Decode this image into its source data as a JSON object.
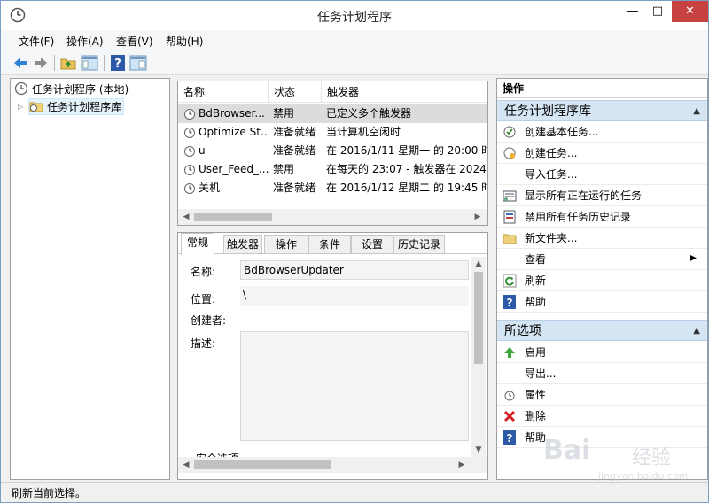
{
  "window": {
    "title": "任务计划程序"
  },
  "menubar": {
    "items": [
      "文件(F)",
      "操作(A)",
      "查看(V)",
      "帮助(H)"
    ]
  },
  "toolbar": {
    "icons": [
      "back-icon",
      "forward-icon",
      "up-folder-icon",
      "show-hide-tree-icon",
      "help-icon",
      "show-hide-action-pane-icon"
    ]
  },
  "tree": {
    "root": "任务计划程序 (本地)",
    "child": "任务计划程序库"
  },
  "task_list": {
    "columns": [
      "名称",
      "状态",
      "触发器"
    ],
    "rows": [
      {
        "name": "BdBrowser...",
        "status": "禁用",
        "trigger": "已定义多个触发器"
      },
      {
        "name": "Optimize St...",
        "status": "准备就绪",
        "trigger": "当计算机空闲时"
      },
      {
        "name": "u",
        "status": "准备就绪",
        "trigger": "在 2016/1/11 星期一 的 20:00 时"
      },
      {
        "name": "User_Feed_...",
        "status": "禁用",
        "trigger": "在每天的 23:07 - 触发器在 2024/"
      },
      {
        "name": "关机",
        "status": "准备就绪",
        "trigger": "在 2016/1/12 星期二 的 19:45 时"
      }
    ]
  },
  "detail": {
    "tabs": [
      "常规",
      "触发器",
      "操作",
      "条件",
      "设置",
      "历史记录"
    ],
    "name_label": "名称:",
    "name_value": "BdBrowserUpdater",
    "location_label": "位置:",
    "location_value": "\\",
    "author_label": "创建者:",
    "description_label": "描述:",
    "security_label": "安全选项"
  },
  "actions": {
    "title": "操作",
    "library_section": "任务计划程序库",
    "library_items": [
      {
        "label": "创建基本任务...",
        "icon": "create-basic-task-icon"
      },
      {
        "label": "创建任务...",
        "icon": "create-task-icon"
      },
      {
        "label": "导入任务...",
        "icon": ""
      },
      {
        "label": "显示所有正在运行的任务",
        "icon": "running-tasks-icon"
      },
      {
        "label": "禁用所有任务历史记录",
        "icon": "history-icon"
      },
      {
        "label": "新文件夹...",
        "icon": "new-folder-icon"
      },
      {
        "label": "查看",
        "icon": ""
      },
      {
        "label": "刷新",
        "icon": "refresh-icon"
      },
      {
        "label": "帮助",
        "icon": "help-icon"
      }
    ],
    "selected_section": "所选项",
    "selected_items": [
      {
        "label": "启用",
        "icon": "enable-icon"
      },
      {
        "label": "导出...",
        "icon": ""
      },
      {
        "label": "属性",
        "icon": "properties-icon"
      },
      {
        "label": "删除",
        "icon": "delete-icon"
      },
      {
        "label": "帮助",
        "icon": "help-icon"
      }
    ]
  },
  "statusbar": {
    "text": "刷新当前选择。"
  },
  "watermark": {
    "logo": "Bai",
    "cn": "经验",
    "url": "jingyan.baidu.com"
  }
}
